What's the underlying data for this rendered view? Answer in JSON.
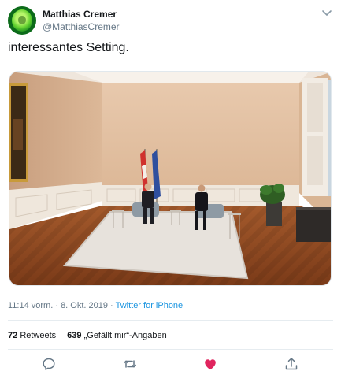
{
  "user": {
    "name": "Matthias Cremer",
    "handle": "@MatthiasCremer"
  },
  "tweet": {
    "text": "interessantes Setting."
  },
  "meta": {
    "time": "11:14 vorm.",
    "separator1": " · ",
    "date": "8. Okt. 2019",
    "separator2": " · ",
    "source": "Twitter for iPhone"
  },
  "stats": {
    "retweets_count": "72",
    "retweets_label": "Retweets",
    "likes_count": "639",
    "likes_label": "„Gefällt mir“-Angaben"
  },
  "colors": {
    "link": "#1b95e0",
    "like": "#e0245e",
    "muted": "#657786"
  },
  "icons": {
    "menu": "chevron-down-icon",
    "reply": "reply-icon",
    "retweet": "retweet-icon",
    "like": "heart-icon",
    "share": "share-icon"
  }
}
